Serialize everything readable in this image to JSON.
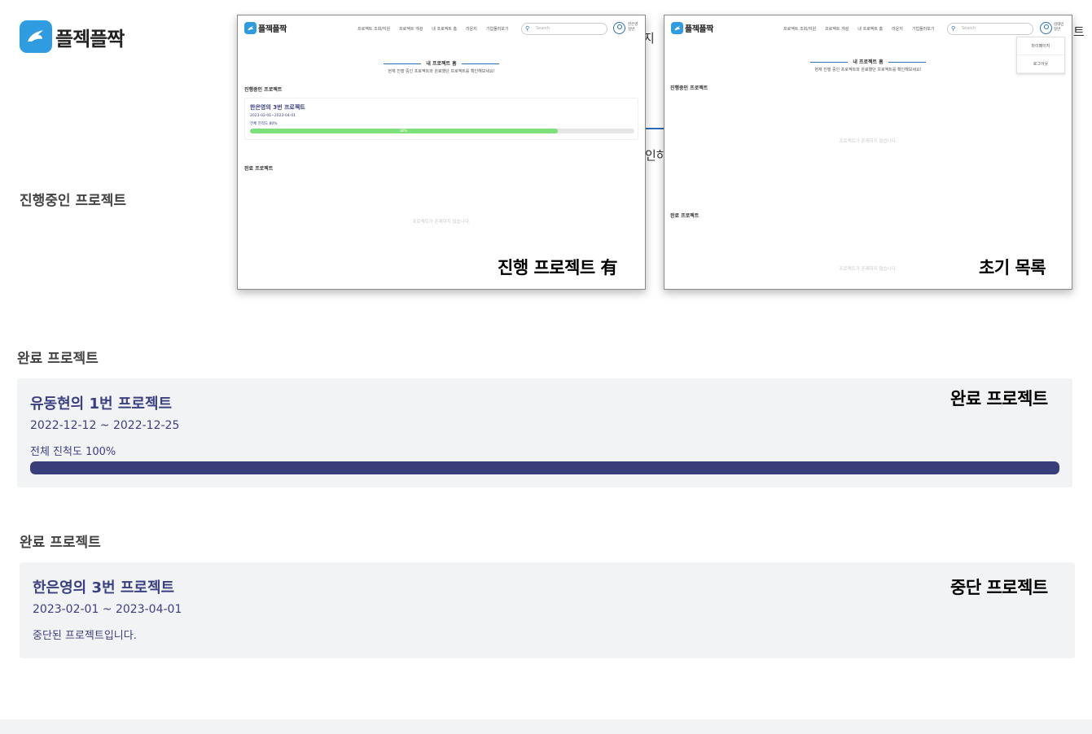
{
  "brand": {
    "name": "플젝플짝",
    "color": "#2f9be0",
    "icon": "rabbit-logo-icon"
  },
  "background": {
    "frag_top": "지",
    "frag_mid": "인하",
    "frag_right": "트"
  },
  "sections": {
    "in_progress_title": "진행중인 프로젝트",
    "completed_title": "완료 프로젝트",
    "stopped_title": "완료 프로젝트"
  },
  "screenshot_a": {
    "brand": "플젝플짝",
    "menu": [
      "프로젝트 조회/지원",
      "프로젝트 개설",
      "내 프로젝트 홈",
      "라운지",
      "기업둘러보기"
    ],
    "search_placeholder": "Search",
    "user_name": "한은영",
    "user_role": "일반",
    "heading": "내 프로젝트 홈",
    "subheading": "현재 진행 중인 프로젝트와 완료했던 프로젝트를 확인해보세요!",
    "in_progress": "진행중인 프로젝트",
    "project_name": "한은영의 3번 프로젝트",
    "project_dates": "2023-02-01~2023-04-01",
    "project_progress_text": "전체 진척도 80%",
    "project_progress": 80,
    "project_progress_label": "80%",
    "completed": "완료 프로젝트",
    "empty_text": "프로젝트가 존재하지 않습니다.",
    "caption": "진행 프로젝트 有"
  },
  "screenshot_b": {
    "brand": "플젝플짝",
    "menu": [
      "프로젝트 조회/지원",
      "프로젝트 개설",
      "내 프로젝트 홈",
      "라운지",
      "기업둘러보기"
    ],
    "search_placeholder": "Search",
    "user_name": "김태민",
    "user_role": "일반",
    "dropdown": [
      "마이페이지",
      "로그아웃"
    ],
    "heading": "내 프로젝트 홈",
    "subheading": "현재 진행 중인 프로젝트와 완료했던 프로젝트를 확인해보세요!",
    "in_progress": "진행중인 프로젝트",
    "empty_text": "프로젝트가 존재하지 않습니다.",
    "completed": "완료 프로젝트",
    "caption": "초기 목록"
  },
  "completed_card": {
    "name": "유동현의 1번 프로젝트",
    "dates": "2022-12-12 ~ 2022-12-25",
    "progress_text": "전체 진척도 100%",
    "progress": 100,
    "bar_color": "#383e7a",
    "caption": "완료 프로젝트"
  },
  "stopped_card": {
    "name": "한은영의 3번 프로젝트",
    "dates": "2023-02-01 ~ 2023-04-01",
    "status_text": "중단된 프로젝트입니다.",
    "caption": "중단 프로젝트"
  }
}
